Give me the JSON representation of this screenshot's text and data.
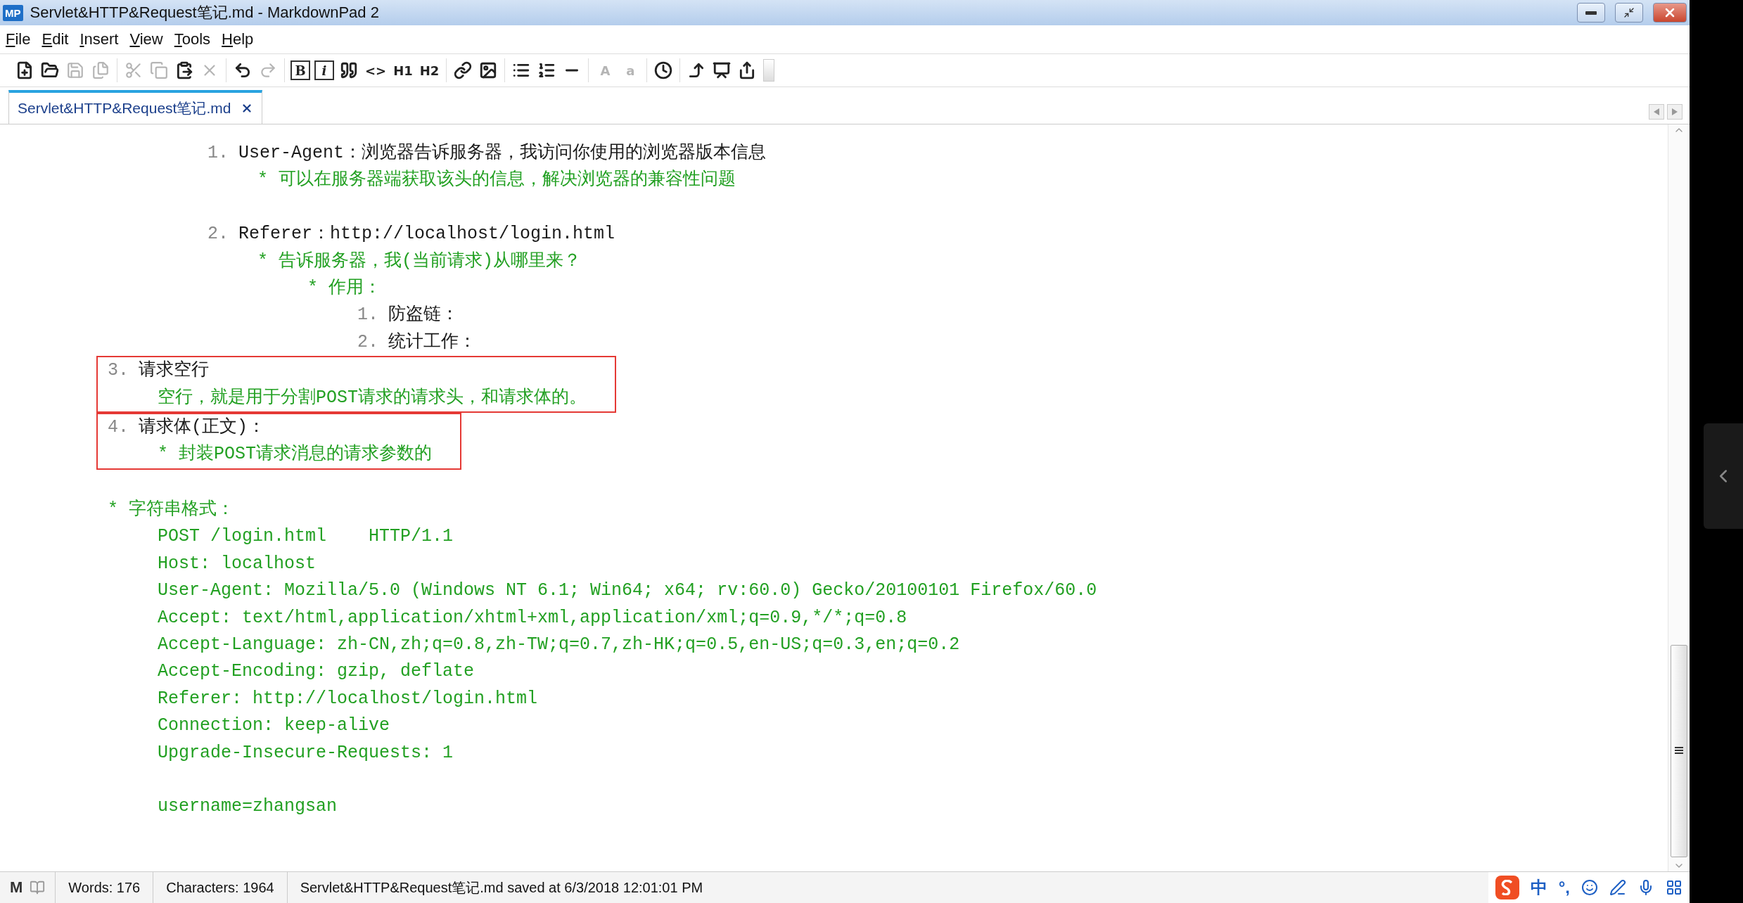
{
  "window": {
    "app_icon": "MP",
    "title": "Servlet&HTTP&Request笔记.md - MarkdownPad 2"
  },
  "menu": [
    {
      "label": "File"
    },
    {
      "label": "Edit"
    },
    {
      "label": "Insert"
    },
    {
      "label": "View"
    },
    {
      "label": "Tools"
    },
    {
      "label": "Help"
    }
  ],
  "toolbar": [
    {
      "items": [
        {
          "kind": "new",
          "disabled": false
        },
        {
          "kind": "open",
          "disabled": false
        },
        {
          "kind": "save",
          "disabled": true
        },
        {
          "kind": "save-all",
          "disabled": true
        }
      ]
    },
    {
      "items": [
        {
          "kind": "cut",
          "disabled": true
        },
        {
          "kind": "copy",
          "disabled": true
        },
        {
          "kind": "paste",
          "disabled": false
        },
        {
          "kind": "delete",
          "disabled": true
        }
      ]
    },
    {
      "items": [
        {
          "kind": "undo",
          "disabled": false
        },
        {
          "kind": "redo",
          "disabled": true
        }
      ]
    },
    {
      "items": [
        {
          "kind": "boxed",
          "label": "B",
          "disabled": false
        },
        {
          "kind": "boxed-italic",
          "label": "i",
          "disabled": false
        },
        {
          "kind": "quote",
          "disabled": false
        },
        {
          "kind": "text",
          "label": "<>",
          "disabled": false
        },
        {
          "kind": "text",
          "label": "H1",
          "disabled": false
        },
        {
          "kind": "text",
          "label": "H2",
          "disabled": false
        }
      ]
    },
    {
      "items": [
        {
          "kind": "link",
          "disabled": false
        },
        {
          "kind": "image",
          "disabled": false
        }
      ]
    },
    {
      "items": [
        {
          "kind": "bullets",
          "disabled": false
        },
        {
          "kind": "numbers",
          "disabled": false
        },
        {
          "kind": "rule",
          "disabled": false
        }
      ]
    },
    {
      "items": [
        {
          "kind": "text",
          "label": "A",
          "disabled": true
        },
        {
          "kind": "text",
          "label": "a",
          "disabled": true
        }
      ]
    },
    {
      "items": [
        {
          "kind": "clock",
          "disabled": false
        }
      ]
    },
    {
      "items": [
        {
          "kind": "jump",
          "disabled": false
        },
        {
          "kind": "preview",
          "disabled": false
        },
        {
          "kind": "export",
          "disabled": false
        }
      ]
    }
  ],
  "tabs": [
    {
      "label": "Servlet&HTTP&Request笔记.md",
      "selected": true
    }
  ],
  "editor": {
    "request_headers": [
      {
        "kind": "item",
        "marker": "1.",
        "text": "User-Agent：浏览器告诉服务器，我访问你使用的浏览器版本信息",
        "children": [
          {
            "kind": "note",
            "text": "* 可以在服务器端获取该头的信息，解决浏览器的兼容性问题"
          },
          {
            "kind": "blank"
          }
        ]
      },
      {
        "kind": "item",
        "marker": "2.",
        "text": "Referer：http://localhost/login.html",
        "children": [
          {
            "kind": "note",
            "text": "* 告诉服务器，我(当前请求)从哪里来？",
            "children": [
              {
                "kind": "note",
                "text": "* 作用：",
                "children": [
                  {
                    "kind": "item",
                    "marker": "1.",
                    "text": "防盗链："
                  },
                  {
                    "kind": "item",
                    "marker": "2.",
                    "text": "统计工作："
                  }
                ]
              }
            ]
          }
        ]
      }
    ],
    "sections": [
      {
        "kind": "item",
        "marker": "3.",
        "text": "请求空行",
        "highlighted": true,
        "children": [
          {
            "kind": "note",
            "text": "空行，就是用于分割POST请求的请求头，和请求体的。"
          }
        ]
      },
      {
        "kind": "item",
        "marker": "4.",
        "text": "请求体(正文)：",
        "highlighted": true,
        "children": [
          {
            "kind": "note",
            "text": "* 封装POST请求消息的请求参数的"
          }
        ]
      },
      {
        "kind": "blank"
      },
      {
        "kind": "note",
        "text": "* 字符串格式：",
        "children": [
          {
            "kind": "note",
            "text": "POST /login.html    HTTP/1.1"
          },
          {
            "kind": "note",
            "text": "Host: localhost"
          },
          {
            "kind": "note",
            "text": "User-Agent: Mozilla/5.0 (Windows NT 6.1; Win64; x64; rv:60.0) Gecko/20100101 Firefox/60.0"
          },
          {
            "kind": "note",
            "text": "Accept: text/html,application/xhtml+xml,application/xml;q=0.9,*/*;q=0.8"
          },
          {
            "kind": "note",
            "text": "Accept-Language: zh-CN,zh;q=0.8,zh-TW;q=0.7,zh-HK;q=0.5,en-US;q=0.3,en;q=0.2"
          },
          {
            "kind": "note",
            "text": "Accept-Encoding: gzip, deflate"
          },
          {
            "kind": "note",
            "text": "Referer: http://localhost/login.html"
          },
          {
            "kind": "note",
            "text": "Connection: keep-alive"
          },
          {
            "kind": "note",
            "text": "Upgrade-Insecure-Requests: 1"
          },
          {
            "kind": "blank"
          },
          {
            "kind": "note",
            "text": "username=zhangsan"
          }
        ]
      }
    ]
  },
  "status_bar": {
    "logo": "M",
    "words": "Words: 176",
    "characters": "Characters: 1964",
    "message": "Servlet&HTTP&Request笔记.md saved at 6/3/2018 12:01:01 PM"
  },
  "ime": {
    "mode": "中",
    "punctuation": "°,"
  }
}
